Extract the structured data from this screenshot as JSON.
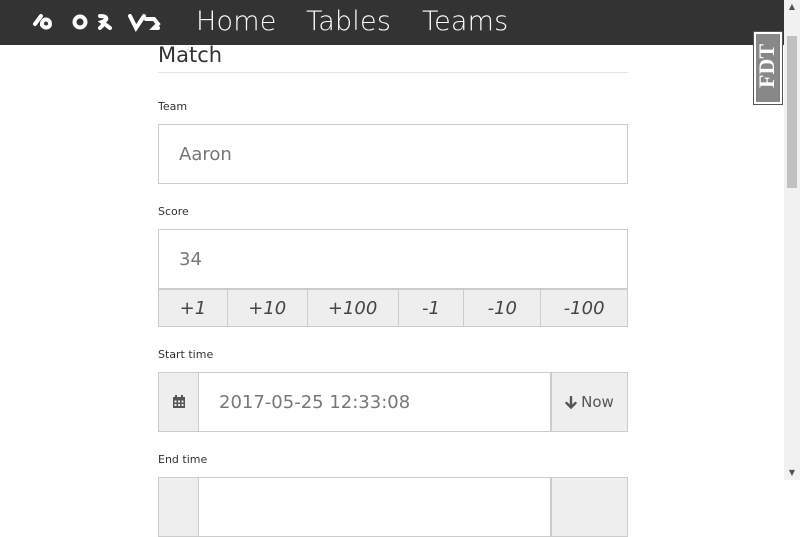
{
  "nav": {
    "logo_icon": "abstract-glyph-logo",
    "links": [
      "Home",
      "Tables",
      "Teams"
    ]
  },
  "badge": {
    "text": "FDT"
  },
  "form": {
    "title": "Match",
    "team": {
      "label": "Team",
      "value": "Aaron"
    },
    "score": {
      "label": "Score",
      "value": "34",
      "buttons": [
        "+1",
        "+10",
        "+100",
        "-1",
        "-10",
        "-100"
      ]
    },
    "start_time": {
      "label": "Start time",
      "value": "2017-05-25 12:33:08",
      "now_label": "Now",
      "icon": "calendar-icon"
    },
    "end_time": {
      "label": "End time"
    }
  },
  "colors": {
    "navbar": "#333333",
    "addon_bg": "#eeeeee",
    "border": "#cccccc"
  }
}
